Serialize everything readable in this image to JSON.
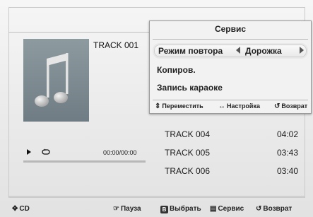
{
  "main": {
    "track_title": "TRACK 001",
    "time": "00:00/00:00",
    "progress_fraction": 0.0,
    "play_icon": "play-icon",
    "repeat_icon": "repeat-icon"
  },
  "tracks": [
    {
      "name": "TRACK 004",
      "duration": "04:02"
    },
    {
      "name": "TRACK 005",
      "duration": "03:43"
    },
    {
      "name": "TRACK 006",
      "duration": "03:40"
    }
  ],
  "popup": {
    "title": "Сервис",
    "options": [
      {
        "label": "Режим повтора",
        "value": "Дорожка"
      },
      {
        "label": "Копиров."
      },
      {
        "label": "Запись караоке"
      }
    ],
    "footer": {
      "move": "Переместить",
      "adjust": "Настройка",
      "back": "Возврат"
    }
  },
  "bottom": {
    "source": "CD",
    "pause": "Пауза",
    "select_key": "B",
    "select": "Выбрать",
    "service": "Сервис",
    "back": "Возврат"
  },
  "colors": {
    "background": "#ececec",
    "album_bg": "#7f8b91",
    "note_color": "#cfcfcf"
  }
}
